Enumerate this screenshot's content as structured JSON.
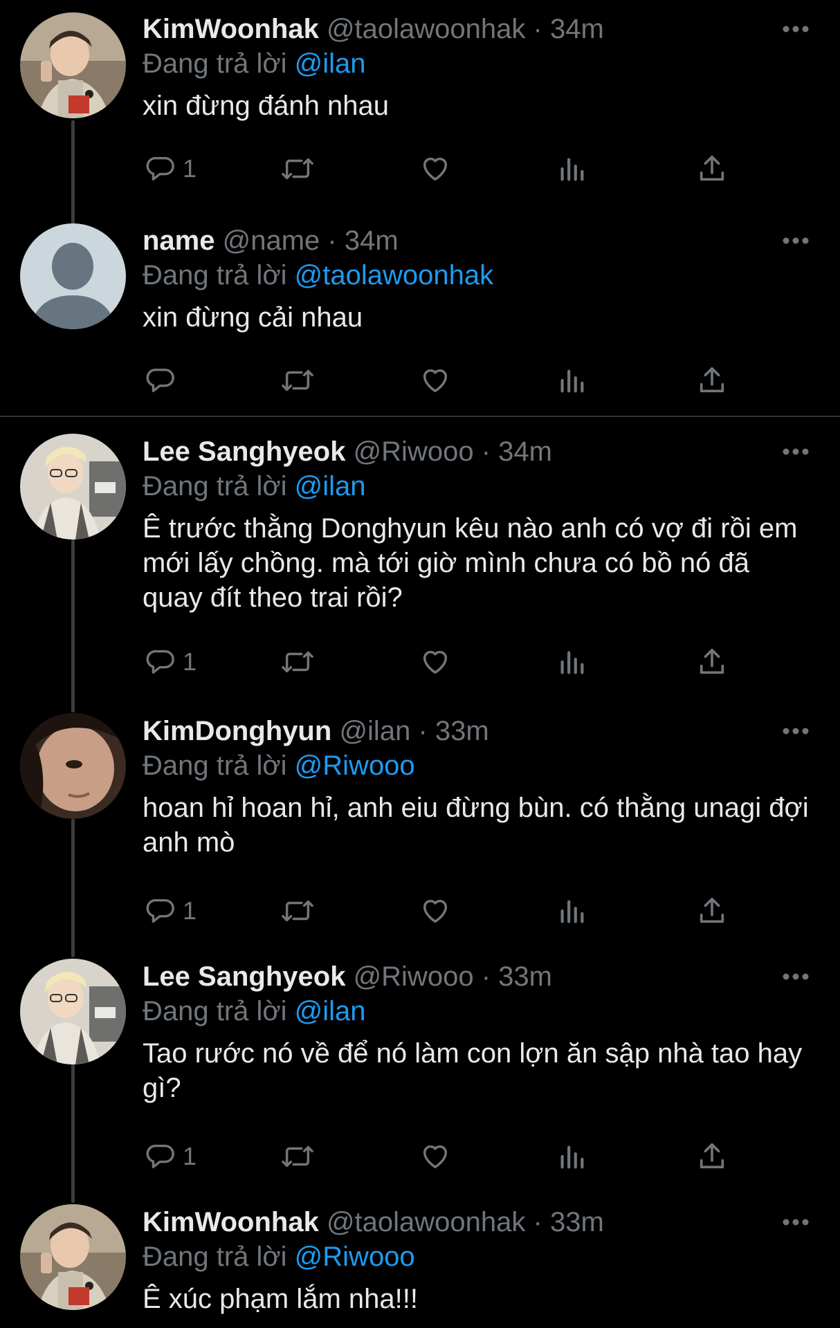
{
  "reply_prefix": "Đang trả lời",
  "tweets": [
    {
      "name": "KimWoonhak",
      "handle": "@taolawoonhak",
      "sep": "·",
      "time": "34m",
      "replying_to": "@ilan",
      "text": "xin đừng đánh nhau",
      "reply_count": "1",
      "avatar": "photo-avatar"
    },
    {
      "name": "name",
      "handle": "@name",
      "sep": "·",
      "time": "34m",
      "replying_to": "@taolawoonhak",
      "text": "xin đừng cải nhau",
      "reply_count": "",
      "avatar": "default-avatar"
    },
    {
      "name": "Lee Sanghyeok",
      "handle": "@Riwooo",
      "sep": "·",
      "time": "34m",
      "replying_to": "@ilan",
      "text": "Ê trước thằng Donghyun kêu nào anh có vợ đi rồi em mới lấy chồng. mà tới giờ mình chưa có bồ nó đã quay đít theo trai rồi?",
      "reply_count": "1",
      "avatar": "photo-avatar"
    },
    {
      "name": "KimDonghyun",
      "handle": "@ilan",
      "sep": "·",
      "time": "33m",
      "replying_to": "@Riwooo",
      "text": "hoan hỉ hoan hỉ, anh eiu đừng bùn. có thằng unagi đợi anh mò",
      "reply_count": "1",
      "avatar": "photo-avatar"
    },
    {
      "name": "Lee Sanghyeok",
      "handle": "@Riwooo",
      "sep": "·",
      "time": "33m",
      "replying_to": "@ilan",
      "text": "Tao rước nó về để nó làm con lợn ăn sập nhà tao hay gì?",
      "reply_count": "1",
      "avatar": "photo-avatar"
    },
    {
      "name": "KimWoonhak",
      "handle": "@taolawoonhak",
      "sep": "·",
      "time": "33m",
      "replying_to": "@Riwooo",
      "text": "Ê xúc phạm lắm nha!!!",
      "reply_count": "",
      "avatar": "photo-avatar"
    }
  ],
  "icons": {
    "more": "more-horizontal-icon",
    "reply": "reply-bubble-icon",
    "retweet": "retweet-icon",
    "like": "heart-icon",
    "views": "views-bar-icon",
    "share": "share-upload-icon"
  },
  "colors": {
    "background": "#000000",
    "text": "#e7e9ea",
    "muted": "#71767b",
    "mention": "#1d9bf0",
    "thread_line": "#3a3d40",
    "divider": "#2f3336"
  }
}
